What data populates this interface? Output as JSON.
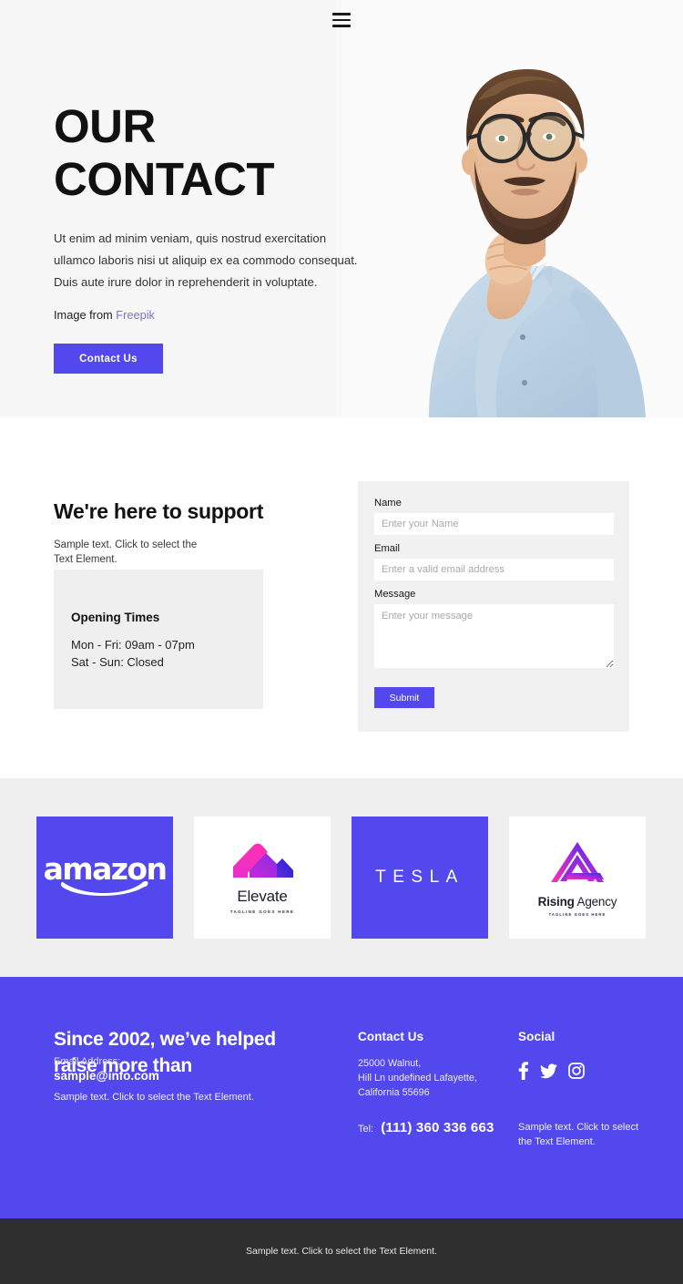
{
  "header": {
    "menu_icon": "hamburger-menu-icon"
  },
  "hero": {
    "title_line1": "OUR",
    "title_line2": "CONTACT",
    "description": "Ut enim ad minim veniam, quis nostrud exercitation ullamco laboris nisi ut aliquip ex ea commodo consequat. Duis aute irure dolor in reprehenderit in voluptate.",
    "credit_prefix": "Image from",
    "credit_link": "Freepik",
    "cta_label": "Contact Us",
    "image_alt": "man-with-glasses-thinking-photo"
  },
  "support": {
    "title": "We're here to support",
    "subtitle": "Sample text. Click to select the Text Element.",
    "hours": {
      "title": "Opening Times",
      "line1": "Mon - Fri: 09am - 07pm",
      "line2": "Sat - Sun: Closed"
    }
  },
  "form": {
    "name_label": "Name",
    "name_placeholder": "Enter your Name",
    "email_label": "Email",
    "email_placeholder": "Enter a valid email address",
    "message_label": "Message",
    "message_placeholder": "Enter your message",
    "submit_label": "Submit"
  },
  "logos": [
    {
      "name": "amazon",
      "text": "amazon",
      "style": "purple"
    },
    {
      "name": "elevate",
      "text": "Elevate",
      "tagline": "TAGLINE GOES HERE",
      "style": "white"
    },
    {
      "name": "tesla",
      "text": "TESLA",
      "style": "purple"
    },
    {
      "name": "rising-agency",
      "text_bold": "Rising",
      "text_light": "Agency",
      "tagline": "TAGLINE GOES HERE",
      "style": "white"
    }
  ],
  "footer": {
    "headline_line1": "Since 2002, we’ve helped",
    "headline_line2": "raise more than",
    "email_label": "Email Address:",
    "email_value": "sample@info.com",
    "sample_text_left": "Sample text. Click to select the Text Element.",
    "contact": {
      "title": "Contact Us",
      "address_line1": "25000 Walnut,",
      "address_line2": "Hill Ln undefined Lafayette,",
      "address_line3": "California 55696",
      "tel_label": "Tel:",
      "tel_value": "(111) 360 336 663"
    },
    "social": {
      "title": "Social",
      "icons": [
        "facebook-icon",
        "twitter-icon",
        "instagram-icon"
      ],
      "sample_text": "Sample text. Click to select the Text Element."
    }
  },
  "bottom_bar": {
    "text": "Sample text. Click to select the Text Element."
  },
  "colors": {
    "accent": "#5348ee",
    "link": "#7d73c7",
    "light_gray": "#efefef",
    "hero_bg": "#f7f7f8",
    "dark_bar": "#2f2f2f"
  }
}
